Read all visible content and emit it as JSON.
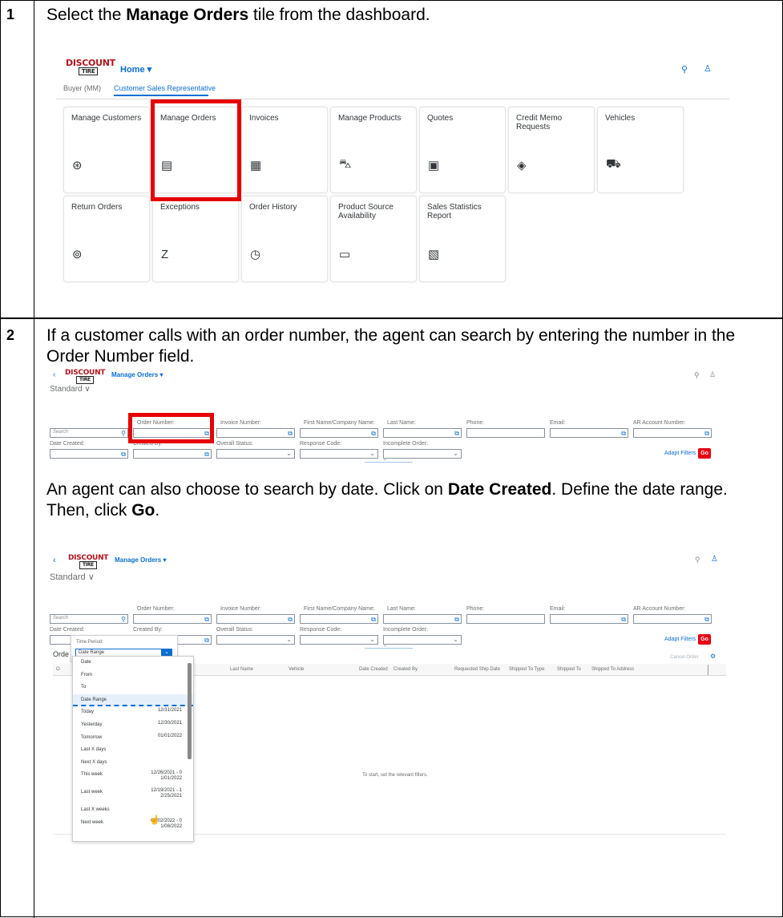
{
  "rows": [
    {
      "num": "1",
      "instr_pre": "Select the ",
      "instr_bold": "Manage Orders",
      "instr_post": " tile from the dashboard."
    },
    {
      "num": "2",
      "instr_a": "If a customer calls with an order number, the agent can search by entering the number in the Order Number field.",
      "instr_b_pre": "An agent can also choose to search by date. Click on ",
      "instr_b_bold1": "Date Created",
      "instr_b_mid": ". Define the date range. Then, click ",
      "instr_b_bold2": "Go",
      "instr_b_post": "."
    }
  ],
  "logo": {
    "main": "DISCOUNT",
    "sub": "TIRE"
  },
  "dashboard": {
    "home": "Home ▾",
    "tabs": [
      "Buyer (MM)",
      "Customer Sales Representative"
    ],
    "tiles_row1": [
      {
        "label": "Manage Customers",
        "icon": "user-circle-icon"
      },
      {
        "label": "Manage Orders",
        "icon": "order-document-icon"
      },
      {
        "label": "Invoices",
        "icon": "invoice-icon"
      },
      {
        "label": "Manage Products",
        "icon": "product-car-icon"
      },
      {
        "label": "Quotes",
        "icon": "quote-document-icon"
      },
      {
        "label": "Credit Memo Requests",
        "icon": "credit-memo-icon"
      },
      {
        "label": "Vehicles",
        "icon": "vehicle-icon"
      }
    ],
    "tiles_row2": [
      {
        "label": "Return Orders",
        "icon": "return-user-icon"
      },
      {
        "label": "Exceptions",
        "icon": "exceptions-icon"
      },
      {
        "label": "Order History",
        "icon": "clock-icon"
      },
      {
        "label": "Product Source Availability",
        "icon": "calendar-search-icon"
      },
      {
        "label": "Sales Statistics Report",
        "icon": "report-icon"
      }
    ]
  },
  "orders": {
    "title": "Manage Orders ▾",
    "variant": "Standard ∨",
    "search_placeholder": "Search",
    "fields_row1": [
      "Order Number:",
      "Invoice Number:",
      "First Name/Company Name:",
      "Last Name:",
      "Phone:",
      "Email:",
      "AR Account Number:"
    ],
    "fields_row2": [
      "Date Created:",
      "Created By:",
      "Overall Status:",
      "Response Code:",
      "Incomplete Order:"
    ],
    "adapt": "Adapt Filters",
    "go": "Go"
  },
  "table": {
    "prefix": "Orde",
    "prefix2": "O",
    "cancel": "Cancel Order",
    "columns": [
      "Last Name",
      "Vehicle",
      "Date Created",
      "Created By",
      "Requested Ship Date",
      "Shipped To Type",
      "Shipped To",
      "Shipped To Address"
    ],
    "empty": "To start, set the relevant filters."
  },
  "dropdown": {
    "label": "Time Period:",
    "value": "Date Range",
    "items": [
      {
        "label": "Date",
        "value": ""
      },
      {
        "label": "From",
        "value": ""
      },
      {
        "label": "To",
        "value": ""
      },
      {
        "label": "Date Range",
        "value": ""
      },
      {
        "label": "Today",
        "value": "12/31/2021"
      },
      {
        "label": "Yesterday",
        "value": "12/30/2021"
      },
      {
        "label": "Tomorrow",
        "value": "01/01/2022"
      },
      {
        "label": "Last X days",
        "value": ""
      },
      {
        "label": "Next X days",
        "value": ""
      },
      {
        "label": "This week",
        "value": "12/26/2021 - 0\n1/01/2022"
      },
      {
        "label": "Last week",
        "value": "12/19/2021 - 1\n2/25/2021"
      },
      {
        "label": "Last X weeks",
        "value": ""
      },
      {
        "label": "Next week",
        "value": "01/02/2022 - 0\n1/08/2022"
      }
    ]
  },
  "colors": {
    "accent": "#0a6ed1",
    "highlight": "#e60000",
    "go": "#e60012"
  }
}
